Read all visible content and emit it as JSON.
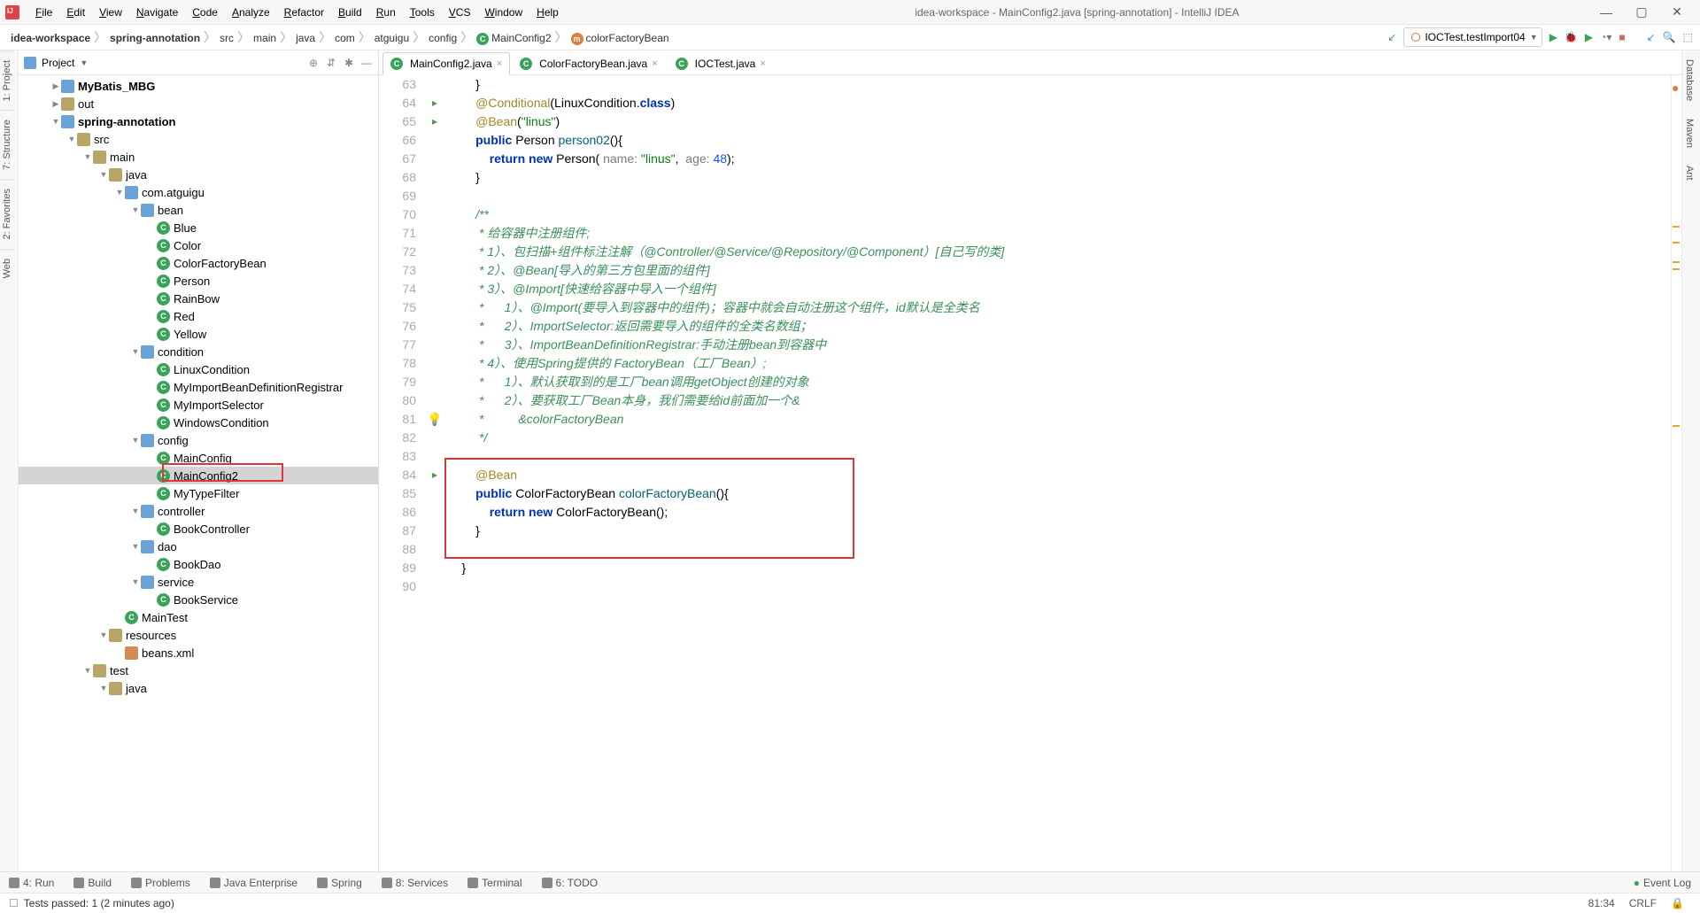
{
  "window": {
    "title": "idea-workspace - MainConfig2.java [spring-annotation] - IntelliJ IDEA"
  },
  "menu": [
    "File",
    "Edit",
    "View",
    "Navigate",
    "Code",
    "Analyze",
    "Refactor",
    "Build",
    "Run",
    "Tools",
    "VCS",
    "Window",
    "Help"
  ],
  "breadcrumbs": [
    {
      "text": "idea-workspace",
      "bold": true
    },
    {
      "text": "spring-annotation",
      "bold": true
    },
    {
      "text": "src"
    },
    {
      "text": "main"
    },
    {
      "text": "java"
    },
    {
      "text": "com"
    },
    {
      "text": "atguigu"
    },
    {
      "text": "config"
    },
    {
      "text": "MainConfig2",
      "icon": "c"
    },
    {
      "text": "colorFactoryBean",
      "icon": "m"
    }
  ],
  "run_config": "IOCTest.testImport04",
  "project_header": "Project",
  "tree": [
    {
      "d": 2,
      "tw": "▶",
      "ic": "mod",
      "t": "MyBatis_MBG",
      "b": true
    },
    {
      "d": 2,
      "tw": "▶",
      "ic": "dir",
      "t": "out"
    },
    {
      "d": 2,
      "tw": "▼",
      "ic": "mod",
      "t": "spring-annotation",
      "b": true
    },
    {
      "d": 3,
      "tw": "▼",
      "ic": "dir",
      "t": "src"
    },
    {
      "d": 4,
      "tw": "▼",
      "ic": "dir",
      "t": "main"
    },
    {
      "d": 5,
      "tw": "▼",
      "ic": "dir",
      "t": "java"
    },
    {
      "d": 6,
      "tw": "▼",
      "ic": "pkg",
      "t": "com.atguigu"
    },
    {
      "d": 7,
      "tw": "▼",
      "ic": "pkg",
      "t": "bean"
    },
    {
      "d": 8,
      "tw": "",
      "ic": "c",
      "t": "Blue"
    },
    {
      "d": 8,
      "tw": "",
      "ic": "c",
      "t": "Color"
    },
    {
      "d": 8,
      "tw": "",
      "ic": "c",
      "t": "ColorFactoryBean"
    },
    {
      "d": 8,
      "tw": "",
      "ic": "c",
      "t": "Person"
    },
    {
      "d": 8,
      "tw": "",
      "ic": "c",
      "t": "RainBow"
    },
    {
      "d": 8,
      "tw": "",
      "ic": "c",
      "t": "Red"
    },
    {
      "d": 8,
      "tw": "",
      "ic": "c",
      "t": "Yellow"
    },
    {
      "d": 7,
      "tw": "▼",
      "ic": "pkg",
      "t": "condition"
    },
    {
      "d": 8,
      "tw": "",
      "ic": "c",
      "t": "LinuxCondition"
    },
    {
      "d": 8,
      "tw": "",
      "ic": "c",
      "t": "MyImportBeanDefinitionRegistrar"
    },
    {
      "d": 8,
      "tw": "",
      "ic": "c",
      "t": "MyImportSelector"
    },
    {
      "d": 8,
      "tw": "",
      "ic": "c",
      "t": "WindowsCondition"
    },
    {
      "d": 7,
      "tw": "▼",
      "ic": "pkg",
      "t": "config"
    },
    {
      "d": 8,
      "tw": "",
      "ic": "c",
      "t": "MainConfig"
    },
    {
      "d": 8,
      "tw": "",
      "ic": "c",
      "t": "MainConfig2",
      "sel": true
    },
    {
      "d": 8,
      "tw": "",
      "ic": "c",
      "t": "MyTypeFilter"
    },
    {
      "d": 7,
      "tw": "▼",
      "ic": "pkg",
      "t": "controller"
    },
    {
      "d": 8,
      "tw": "",
      "ic": "c",
      "t": "BookController"
    },
    {
      "d": 7,
      "tw": "▼",
      "ic": "pkg",
      "t": "dao"
    },
    {
      "d": 8,
      "tw": "",
      "ic": "c",
      "t": "BookDao"
    },
    {
      "d": 7,
      "tw": "▼",
      "ic": "pkg",
      "t": "service"
    },
    {
      "d": 8,
      "tw": "",
      "ic": "c",
      "t": "BookService"
    },
    {
      "d": 6,
      "tw": "",
      "ic": "c",
      "t": "MainTest"
    },
    {
      "d": 5,
      "tw": "▼",
      "ic": "dir",
      "t": "resources"
    },
    {
      "d": 6,
      "tw": "",
      "ic": "x",
      "t": "beans.xml"
    },
    {
      "d": 4,
      "tw": "▼",
      "ic": "dir",
      "t": "test"
    },
    {
      "d": 5,
      "tw": "▼",
      "ic": "dir",
      "t": "java"
    }
  ],
  "tabs": [
    {
      "label": "MainConfig2.java",
      "ic": "c",
      "active": true
    },
    {
      "label": "ColorFactoryBean.java",
      "ic": "c"
    },
    {
      "label": "IOCTest.java",
      "ic": "c"
    }
  ],
  "code_lines": [
    {
      "n": 63,
      "h": "        }"
    },
    {
      "n": 64,
      "h": "        <span class='an'>@Conditional</span>(LinuxCondition.<span class='k'>class</span>)",
      "mk": "vcs"
    },
    {
      "n": 65,
      "h": "        <span class='an'>@Bean</span>(<span class='str'>\"linus\"</span>)",
      "mk": "vcs"
    },
    {
      "n": 66,
      "h": "        <span class='k'>public</span> Person <span class='fn'>person02</span>(){"
    },
    {
      "n": 67,
      "h": "            <span class='k'>return</span> <span class='k'>new</span> Person( <span class='par'>name:</span> <span class='str'>\"linus\"</span>,  <span class='par'>age:</span> <span class='num'>48</span>);"
    },
    {
      "n": 68,
      "h": "        }"
    },
    {
      "n": 69,
      "h": ""
    },
    {
      "n": 70,
      "h": "        <span class='cm-g'>/**</span>"
    },
    {
      "n": 71,
      "h": "<span class='cm-g'>         * 给容器中注册组件;</span>"
    },
    {
      "n": 72,
      "h": "<span class='cm-g'>         * 1）、包扫描+组件标注注解（@Controller/@Service/@Repository/@Component）[自己写的类]</span>"
    },
    {
      "n": 73,
      "h": "<span class='cm-g'>         * 2）、@Bean[导入的第三方包里面的组件]</span>"
    },
    {
      "n": 74,
      "h": "<span class='cm-g'>         * 3）、@Import[快速给容器中导入一个组件]</span>"
    },
    {
      "n": 75,
      "h": "<span class='cm-g'>         *      1）、@Import(要导入到容器中的组件)；容器中就会自动注册这个组件，id默认是全类名</span>"
    },
    {
      "n": 76,
      "h": "<span class='cm-g'>         *      2）、ImportSelector:返回需要导入的组件的全类名数组；</span>"
    },
    {
      "n": 77,
      "h": "<span class='cm-g'>         *      3）、ImportBeanDefinitionRegistrar:手动注册bean到容器中</span>"
    },
    {
      "n": 78,
      "h": "<span class='cm-g'>         * 4）、使用Spring提供的 FactoryBean（工厂Bean）;</span>"
    },
    {
      "n": 79,
      "h": "<span class='cm-g'>         *      1）、默认获取到的是工厂bean调用getObject创建的对象</span>"
    },
    {
      "n": 80,
      "h": "<span class='cm-g'>         *      2）、要获取工厂Bean本身，我们需要给id前面加一个&amp;</span>"
    },
    {
      "n": 81,
      "h": "<span class='cm-g'>         *          &amp;colorFactoryBean</span>",
      "mk": "bulb"
    },
    {
      "n": 82,
      "h": "<span class='cm-g'>         */</span>"
    },
    {
      "n": 83,
      "h": ""
    },
    {
      "n": 84,
      "h": "        <span class='an'>@Bean</span>",
      "mk": "vcs"
    },
    {
      "n": 85,
      "h": "        <span class='k'>public</span> ColorFactoryBean <span class='fn'>colorFactoryBean</span>(){"
    },
    {
      "n": 86,
      "h": "            <span class='k'>return</span> <span class='k'>new</span> ColorFactoryBean();"
    },
    {
      "n": 87,
      "h": "        }"
    },
    {
      "n": 88,
      "h": ""
    },
    {
      "n": 89,
      "h": "    }"
    },
    {
      "n": 90,
      "h": ""
    }
  ],
  "bottom_tools": [
    "4: Run",
    "Build",
    "Problems",
    "Java Enterprise",
    "Spring",
    "8: Services",
    "Terminal",
    "6: TODO"
  ],
  "event_log": "Event Log",
  "status": {
    "msg": "Tests passed: 1 (2 minutes ago)",
    "pos": "81:34",
    "crlf": "CRLF",
    "lock": "🔒"
  },
  "left_tabs": [
    "1: Project",
    "7: Structure",
    "2: Favorites",
    "Web"
  ],
  "right_tabs": [
    "Database",
    "Maven",
    "Ant"
  ],
  "colors": {
    "accent": "#4a90d9"
  }
}
